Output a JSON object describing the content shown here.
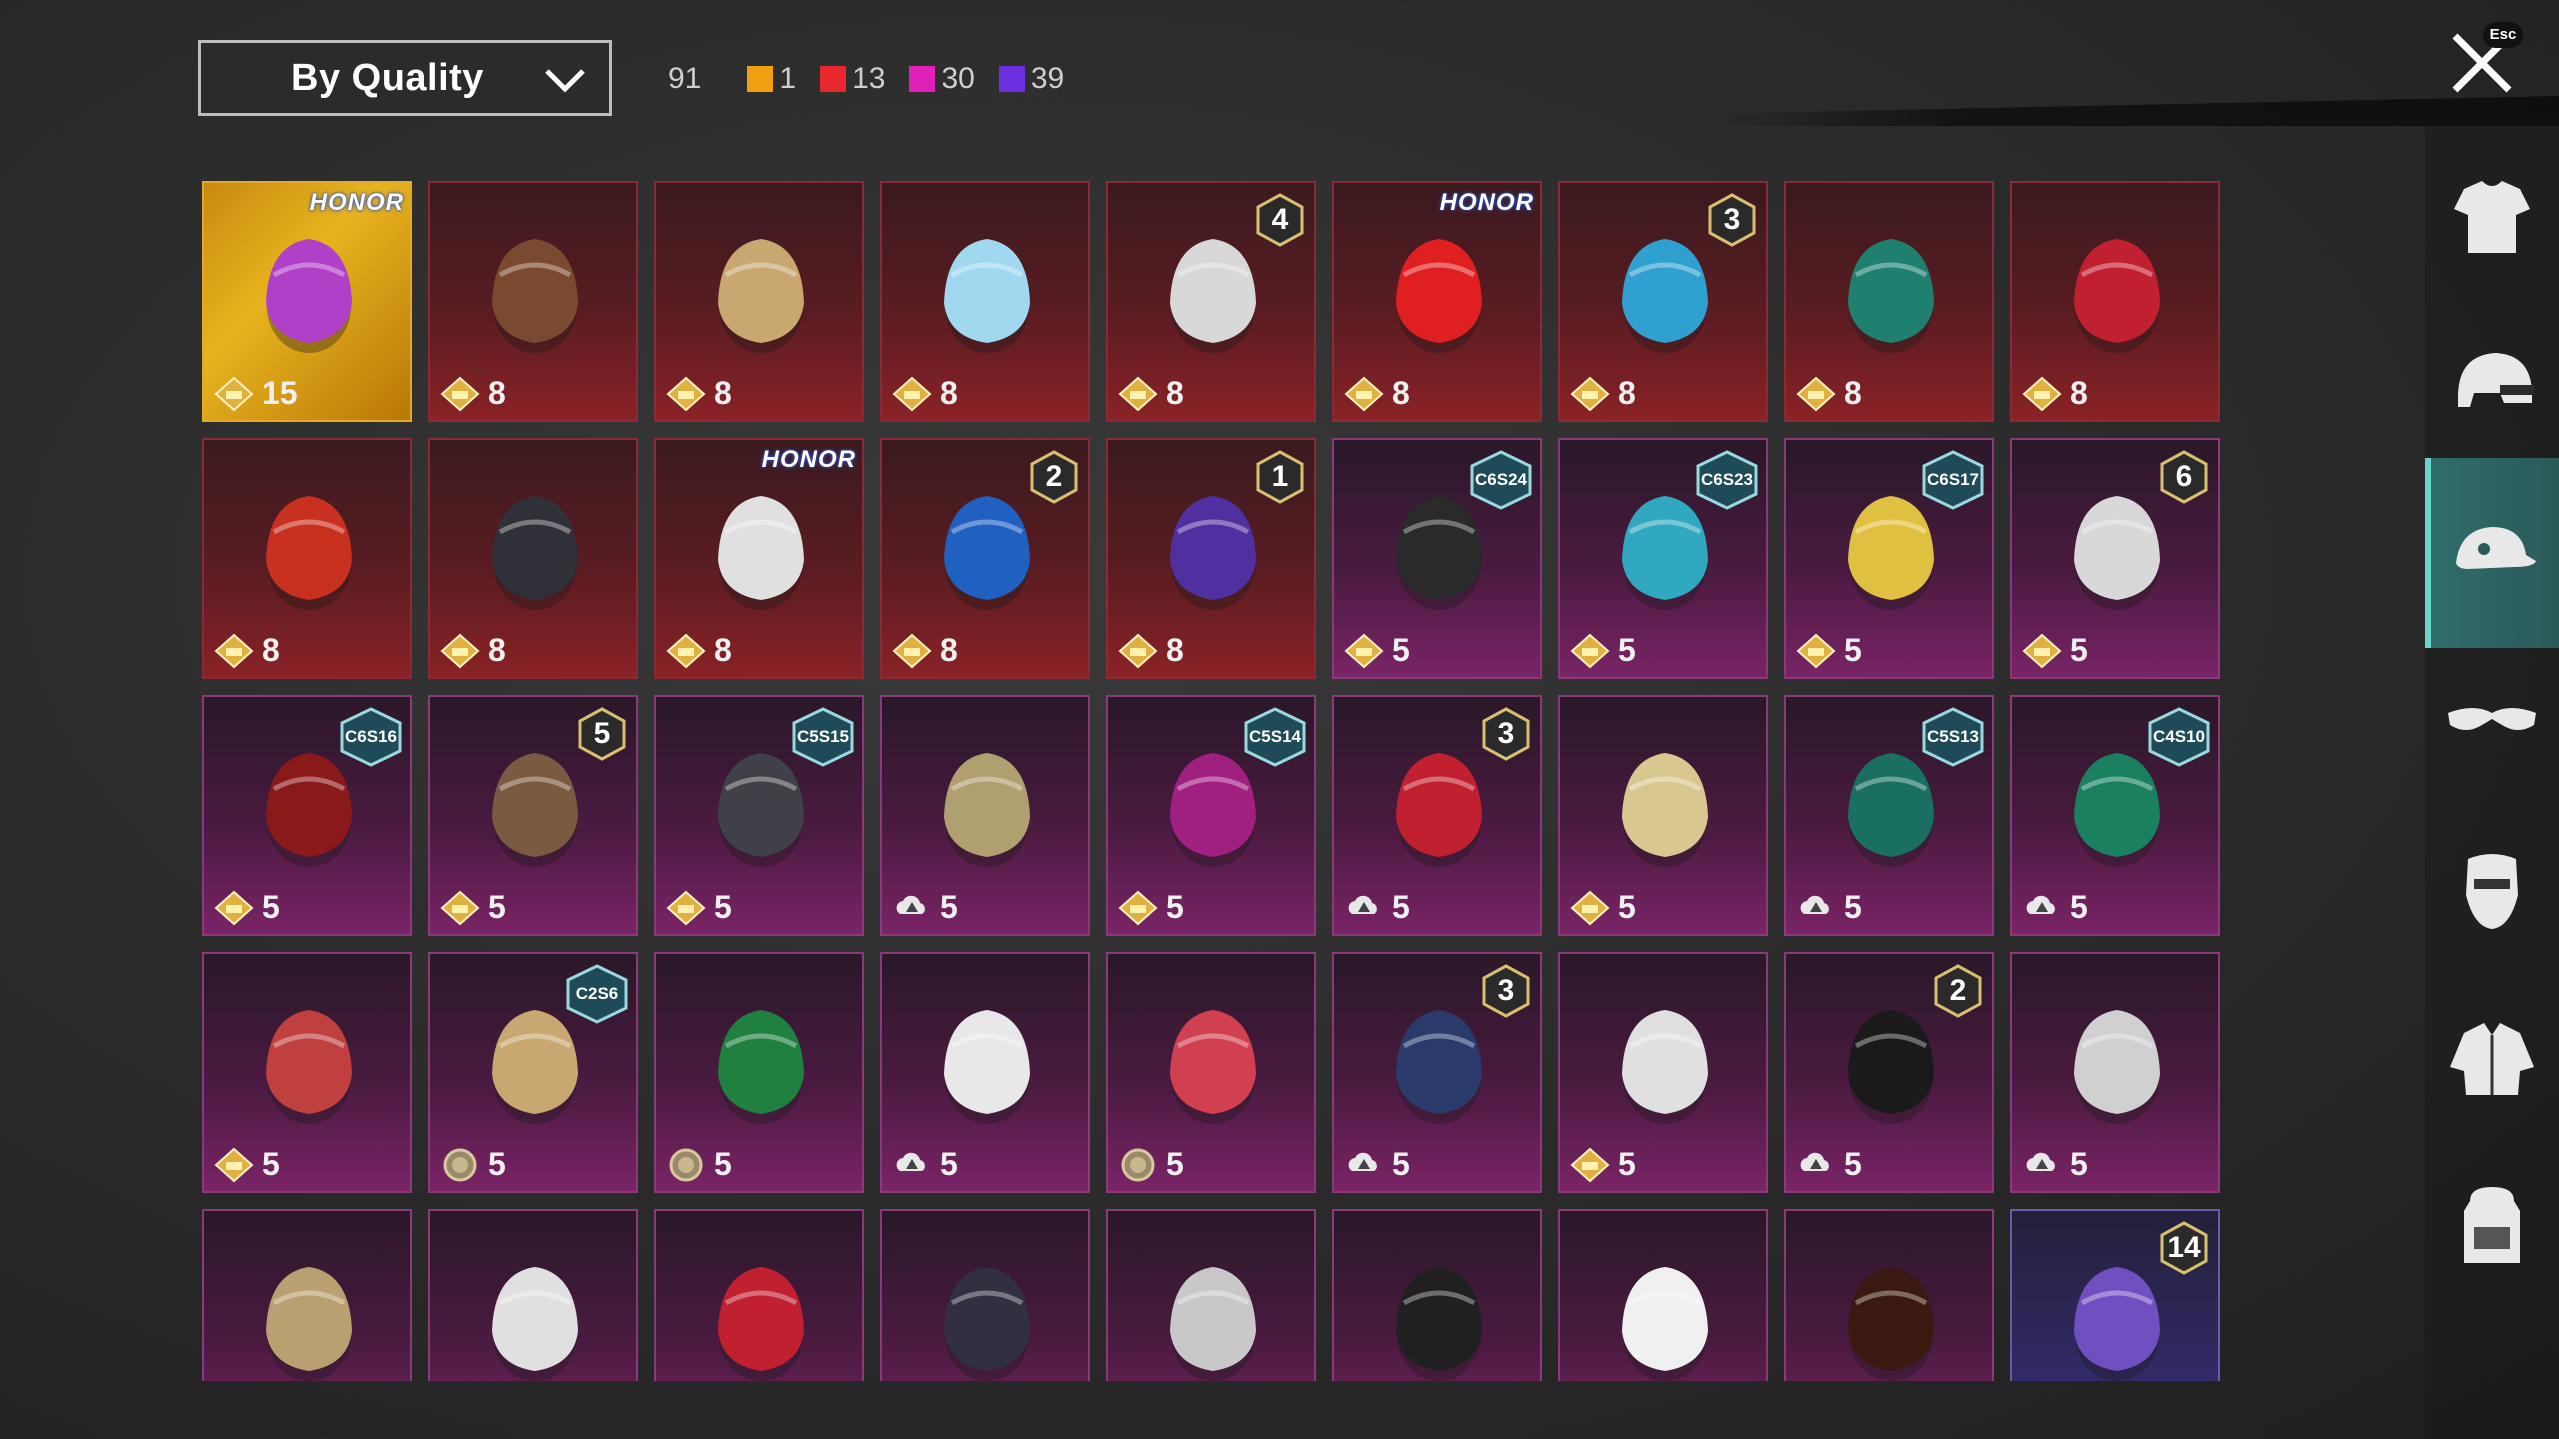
{
  "header": {
    "sort_label": "By Quality",
    "total_count": "91",
    "quality_counts": [
      {
        "color": "#f0a010",
        "count": "1"
      },
      {
        "color": "#e8282c",
        "count": "13"
      },
      {
        "color": "#e020b8",
        "count": "30"
      },
      {
        "color": "#6a30e0",
        "count": "39"
      }
    ],
    "close_hint": "Esc"
  },
  "items": [
    {
      "quality": "gold",
      "value": "15",
      "badge": "HONOR",
      "currency": "premium",
      "art": "#b040c8"
    },
    {
      "quality": "red",
      "value": "8",
      "badge": "",
      "currency": "premium",
      "art": "#7a4a30"
    },
    {
      "quality": "red",
      "value": "8",
      "badge": "",
      "currency": "premium",
      "art": "#c8a870"
    },
    {
      "quality": "red",
      "value": "8",
      "badge": "",
      "currency": "premium",
      "art": "#a0d8f0"
    },
    {
      "quality": "red",
      "value": "8",
      "badge": "4",
      "currency": "premium",
      "art": "#d8d8d8"
    },
    {
      "quality": "red",
      "value": "8",
      "badge": "HONOR",
      "currency": "premium",
      "art": "#e02020"
    },
    {
      "quality": "red",
      "value": "8",
      "badge": "3",
      "currency": "premium",
      "art": "#30a0d0"
    },
    {
      "quality": "red",
      "value": "8",
      "badge": "",
      "currency": "premium",
      "art": "#208070"
    },
    {
      "quality": "red",
      "value": "8",
      "badge": "",
      "currency": "premium",
      "art": "#c02030"
    },
    {
      "quality": "red",
      "value": "8",
      "badge": "",
      "currency": "premium",
      "art": "#c83020"
    },
    {
      "quality": "red",
      "value": "8",
      "badge": "",
      "currency": "premium",
      "art": "#303038"
    },
    {
      "quality": "red",
      "value": "8",
      "badge": "HONOR",
      "currency": "premium",
      "art": "#e0e0e0"
    },
    {
      "quality": "red",
      "value": "8",
      "badge": "2",
      "currency": "premium",
      "art": "#2060c0"
    },
    {
      "quality": "red",
      "value": "8",
      "badge": "1",
      "currency": "premium",
      "art": "#5030a0"
    },
    {
      "quality": "pink",
      "value": "5",
      "badge": "C6S24",
      "currency": "premium",
      "art": "#2a2a2a"
    },
    {
      "quality": "pink",
      "value": "5",
      "badge": "C6S23",
      "currency": "premium",
      "art": "#30a8c0"
    },
    {
      "quality": "pink",
      "value": "5",
      "badge": "C6S17",
      "currency": "premium",
      "art": "#e0c040"
    },
    {
      "quality": "pink",
      "value": "5",
      "badge": "6",
      "currency": "premium",
      "art": "#d8d8d8"
    },
    {
      "quality": "pink",
      "value": "5",
      "badge": "C6S16",
      "currency": "premium",
      "art": "#8a1a1a"
    },
    {
      "quality": "pink",
      "value": "5",
      "badge": "5",
      "currency": "premium",
      "art": "#7a5a40"
    },
    {
      "quality": "pink",
      "value": "5",
      "badge": "C5S15",
      "currency": "premium",
      "art": "#404048"
    },
    {
      "quality": "pink",
      "value": "5",
      "badge": "",
      "currency": "cloud",
      "art": "#b0a070"
    },
    {
      "quality": "pink",
      "value": "5",
      "badge": "C5S14",
      "currency": "premium",
      "art": "#a02080"
    },
    {
      "quality": "pink",
      "value": "5",
      "badge": "3",
      "currency": "cloud",
      "art": "#c02030"
    },
    {
      "quality": "pink",
      "value": "5",
      "badge": "",
      "currency": "premium",
      "art": "#d8c890"
    },
    {
      "quality": "pink",
      "value": "5",
      "badge": "C5S13",
      "currency": "cloud",
      "art": "#1a7060"
    },
    {
      "quality": "pink",
      "value": "5",
      "badge": "C4S10",
      "currency": "cloud",
      "art": "#1a8060"
    },
    {
      "quality": "pink",
      "value": "5",
      "badge": "",
      "currency": "premium",
      "art": "#c04040"
    },
    {
      "quality": "pink",
      "value": "5",
      "badge": "C2S6",
      "currency": "silver",
      "art": "#c8a870"
    },
    {
      "quality": "pink",
      "value": "5",
      "badge": "",
      "currency": "silver",
      "art": "#208040"
    },
    {
      "quality": "pink",
      "value": "5",
      "badge": "",
      "currency": "cloud",
      "art": "#e8e8e8"
    },
    {
      "quality": "pink",
      "value": "5",
      "badge": "",
      "currency": "silver",
      "art": "#d04050"
    },
    {
      "quality": "pink",
      "value": "5",
      "badge": "3",
      "currency": "cloud",
      "art": "#2a3a6a"
    },
    {
      "quality": "pink",
      "value": "5",
      "badge": "",
      "currency": "premium",
      "art": "#e0e0e0"
    },
    {
      "quality": "pink",
      "value": "5",
      "badge": "2",
      "currency": "cloud",
      "art": "#1a1a1a"
    },
    {
      "quality": "pink",
      "value": "5",
      "badge": "",
      "currency": "cloud",
      "art": "#d0d0d0"
    },
    {
      "quality": "pink",
      "value": "",
      "badge": "",
      "currency": "",
      "art": "#b8a070"
    },
    {
      "quality": "pink",
      "value": "",
      "badge": "",
      "currency": "",
      "art": "#e0e0e0"
    },
    {
      "quality": "pink",
      "value": "",
      "badge": "",
      "currency": "",
      "art": "#c02030"
    },
    {
      "quality": "pink",
      "value": "",
      "badge": "",
      "currency": "",
      "art": "#303040"
    },
    {
      "quality": "pink",
      "value": "",
      "badge": "",
      "currency": "",
      "art": "#c8c8c8"
    },
    {
      "quality": "pink",
      "value": "",
      "badge": "",
      "currency": "",
      "art": "#202020"
    },
    {
      "quality": "pink",
      "value": "",
      "badge": "",
      "currency": "",
      "art": "#f0f0f0"
    },
    {
      "quality": "pink",
      "value": "",
      "badge": "",
      "currency": "",
      "art": "#3a1a10"
    },
    {
      "quality": "purple",
      "value": "",
      "badge": "14",
      "currency": "",
      "art": "#7050c0"
    }
  ],
  "sidebar": [
    {
      "name": "outfit",
      "icon": "outfit-icon",
      "active": false
    },
    {
      "name": "helmet",
      "icon": "helmet-icon",
      "active": false
    },
    {
      "name": "hat",
      "icon": "cap-icon",
      "active": true
    },
    {
      "name": "glasses",
      "icon": "glasses-icon",
      "active": false
    },
    {
      "name": "mask",
      "icon": "mask-icon",
      "active": false
    },
    {
      "name": "jacket",
      "icon": "jacket-icon",
      "active": false
    },
    {
      "name": "backpack",
      "icon": "backpack-icon",
      "active": false
    }
  ]
}
